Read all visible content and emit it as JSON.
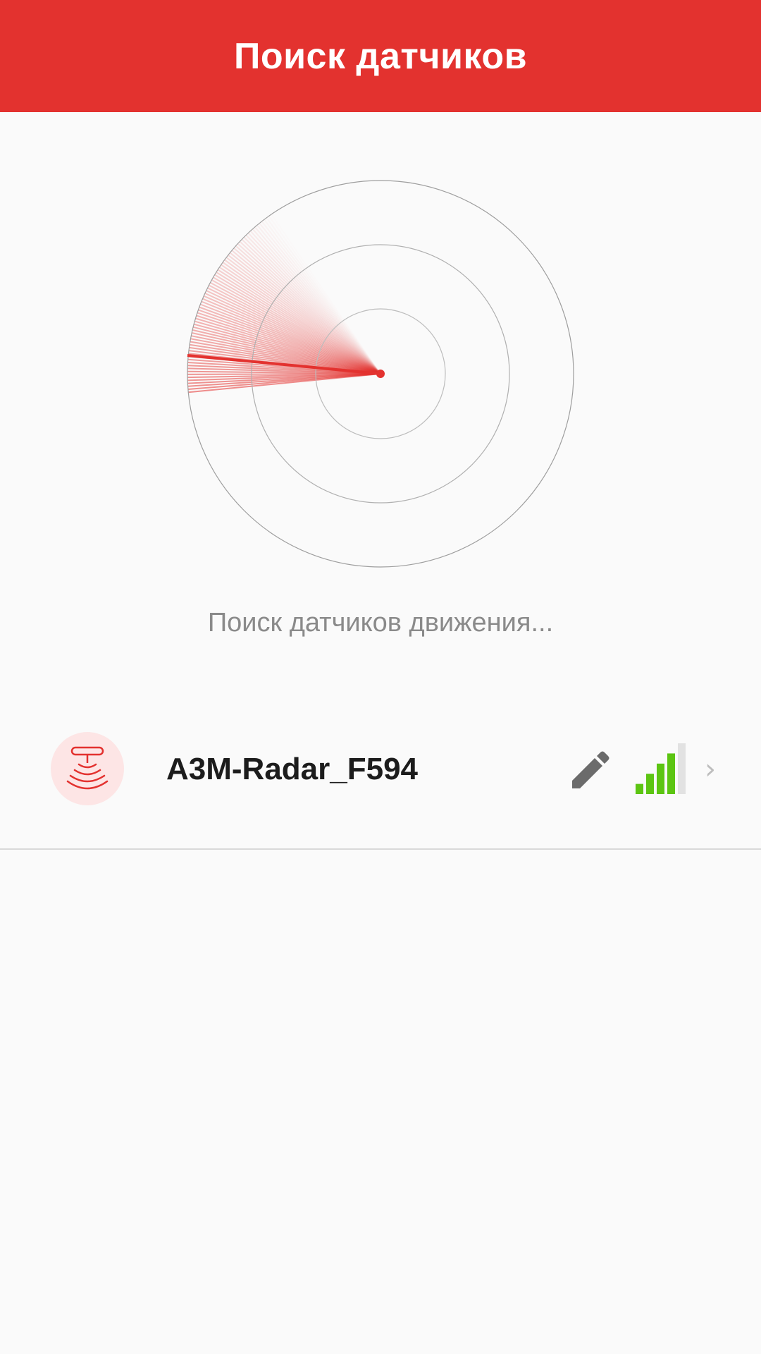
{
  "header": {
    "title": "Поиск датчиков"
  },
  "radar": {
    "status": "Поиск датчиков движения..."
  },
  "devices": [
    {
      "name": "A3M-Radar_F594",
      "icon": "radar-sensor-icon",
      "signal_bars": 4,
      "signal_bars_total": 5
    }
  ],
  "icons": {
    "edit": "pencil-icon",
    "chevron": "›"
  },
  "colors": {
    "accent": "#e3322f",
    "signal_active": "#5cc512",
    "signal_inactive": "#e2e2e2",
    "background": "#fafafa"
  }
}
